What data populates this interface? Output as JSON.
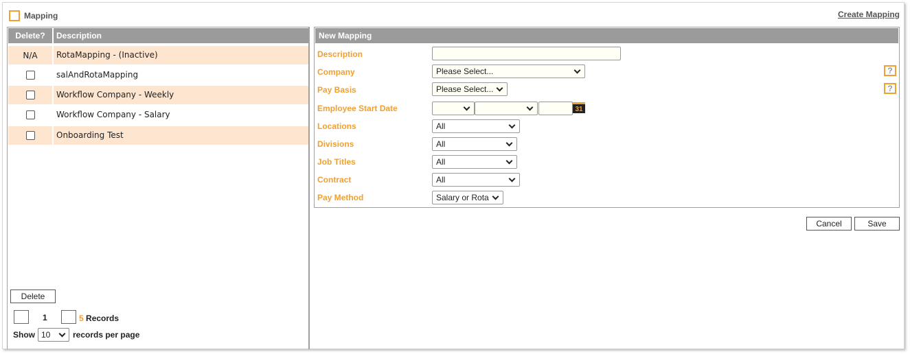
{
  "header": {
    "title": "Mapping",
    "create_link": "Create Mapping"
  },
  "grid": {
    "columns": {
      "delete": "Delete?",
      "description": "Description"
    },
    "rows": [
      {
        "delete": "N/A",
        "description": "RotaMapping - (Inactive)"
      },
      {
        "delete": "",
        "description": "salAndRotaMapping"
      },
      {
        "delete": "",
        "description": "Workflow Company - Weekly"
      },
      {
        "delete": "",
        "description": "Workflow Company - Salary"
      },
      {
        "delete": "",
        "description": "Onboarding Test"
      }
    ],
    "delete_button": "Delete",
    "pager": {
      "page": "1",
      "record_count": "5",
      "records_label": "Records",
      "show_label": "Show",
      "per_page_value": "10",
      "per_page_label": "records per page"
    }
  },
  "form": {
    "title": "New Mapping",
    "labels": {
      "description": "Description",
      "company": "Company",
      "pay_basis": "Pay Basis",
      "employee_start_date": "Employee Start Date",
      "locations": "Locations",
      "divisions": "Divisions",
      "job_titles": "Job Titles",
      "contract": "Contract",
      "pay_method": "Pay Method"
    },
    "values": {
      "description": "",
      "company": "Please Select...",
      "pay_basis": "Please Select...",
      "start_day": "",
      "start_month": "",
      "start_year": "",
      "calendar": "31",
      "locations": "All",
      "divisions": "All",
      "job_titles": "All",
      "contract": "All",
      "pay_method": "Salary or Rota"
    },
    "help_glyph": "?",
    "cancel_button": "Cancel",
    "save_button": "Save"
  },
  "colors": {
    "accent": "#f0a030",
    "header_gray": "#9b9b9b",
    "row_alt": "#fde5d0"
  }
}
